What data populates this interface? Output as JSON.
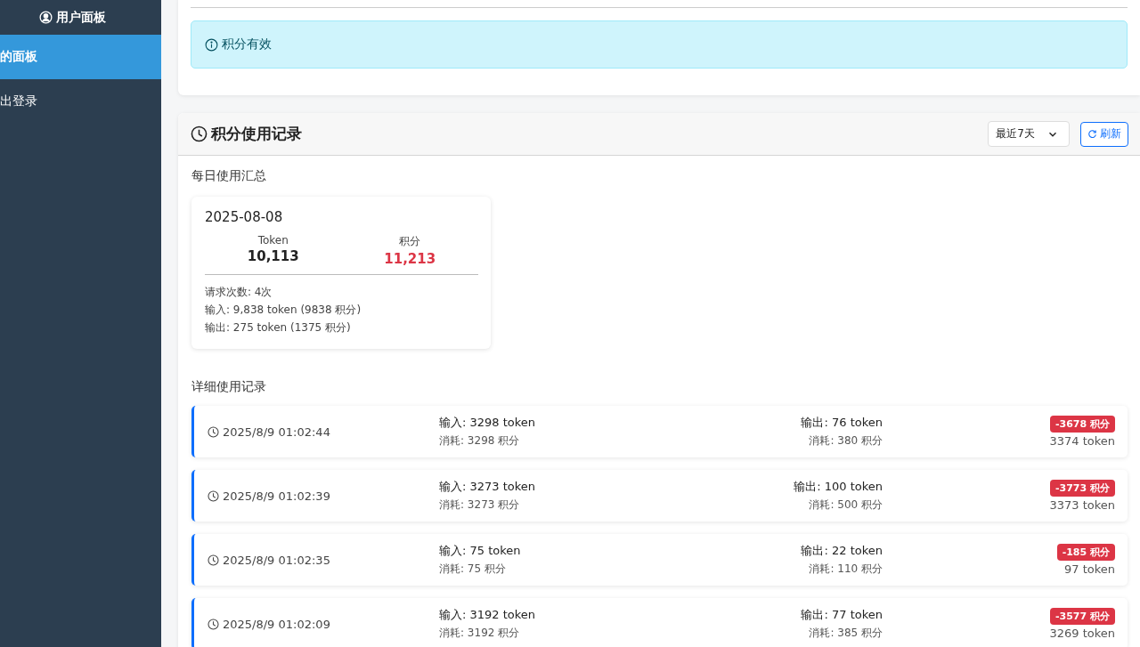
{
  "sidebar": {
    "title": "用户面板",
    "items": [
      {
        "label": "的面板",
        "selected": true
      },
      {
        "label": "出登录",
        "selected": false
      }
    ]
  },
  "alert": {
    "text": "积分有效"
  },
  "usage": {
    "title": "积分使用记录",
    "range": "最近7天",
    "refresh": "刷新",
    "summary_heading": "每日使用汇总",
    "daily": [
      {
        "date": "2025-08-08",
        "token_label": "Token",
        "token_value": "10,113",
        "points_label": "积分",
        "points_value": "11,213",
        "lines": [
          "请求次数: 4次",
          "输入: 9,838 token (9838 积分)",
          "输出: 275 token (1375 积分)"
        ]
      }
    ],
    "detail_heading": "详细使用记录",
    "records": [
      {
        "time": "2025/8/9 01:02:44",
        "input": "输入: 3298 token",
        "input_cost": "消耗: 3298 积分",
        "output": "输出: 76 token",
        "output_cost": "消耗: 380 积分",
        "badge": "-3678 积分",
        "total": "3374 token"
      },
      {
        "time": "2025/8/9 01:02:39",
        "input": "输入: 3273 token",
        "input_cost": "消耗: 3273 积分",
        "output": "输出: 100 token",
        "output_cost": "消耗: 500 积分",
        "badge": "-3773 积分",
        "total": "3373 token"
      },
      {
        "time": "2025/8/9 01:02:35",
        "input": "输入: 75 token",
        "input_cost": "消耗: 75 积分",
        "output": "输出: 22 token",
        "output_cost": "消耗: 110 积分",
        "badge": "-185 积分",
        "total": "97 token"
      },
      {
        "time": "2025/8/9 01:02:09",
        "input": "输入: 3192 token",
        "input_cost": "消耗: 3192 积分",
        "output": "输出: 77 token",
        "output_cost": "消耗: 385 积分",
        "badge": "-3577 积分",
        "total": "3269 token"
      }
    ]
  }
}
